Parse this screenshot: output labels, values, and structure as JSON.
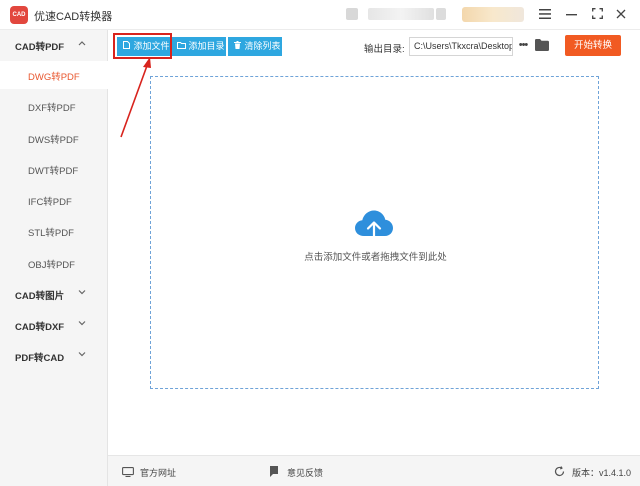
{
  "app": {
    "title": "优速CAD转换器",
    "logo_text": "CAD"
  },
  "window_controls": {
    "menu_icon": "menu-icon",
    "minimize_icon": "minimize-icon",
    "maximize_icon": "maximize-icon",
    "close_icon": "close-icon"
  },
  "sidebar": {
    "categories": [
      {
        "label": "CAD转PDF",
        "expanded": true,
        "items": [
          {
            "label": "DWG转PDF",
            "active": true
          },
          {
            "label": "DXF转PDF",
            "active": false
          },
          {
            "label": "DWS转PDF",
            "active": false
          },
          {
            "label": "DWT转PDF",
            "active": false
          },
          {
            "label": "IFC转PDF",
            "active": false
          },
          {
            "label": "STL转PDF",
            "active": false
          },
          {
            "label": "OBJ转PDF",
            "active": false
          }
        ]
      },
      {
        "label": "CAD转图片",
        "expanded": false
      },
      {
        "label": "CAD转DXF",
        "expanded": false
      },
      {
        "label": "PDF转CAD",
        "expanded": false
      }
    ]
  },
  "toolbar": {
    "add_file_label": "添加文件",
    "add_folder_label": "添加目录",
    "clear_list_label": "清除列表",
    "output_label": "输出目录:",
    "output_path": "C:\\Users\\Tkxcra\\Desktop",
    "more_label": "•••",
    "start_label": "开始转换"
  },
  "dropzone": {
    "hint": "点击添加文件或者拖拽文件到此处"
  },
  "footer": {
    "website_label": "官方网址",
    "feedback_label": "意见反馈",
    "version_label": "版本：v1.4.1.0"
  },
  "colors": {
    "accent_blue": "#2ea7e0",
    "start_orange": "#f15a22",
    "active_item": "#e8572f",
    "annotation_red": "#d8231d"
  }
}
